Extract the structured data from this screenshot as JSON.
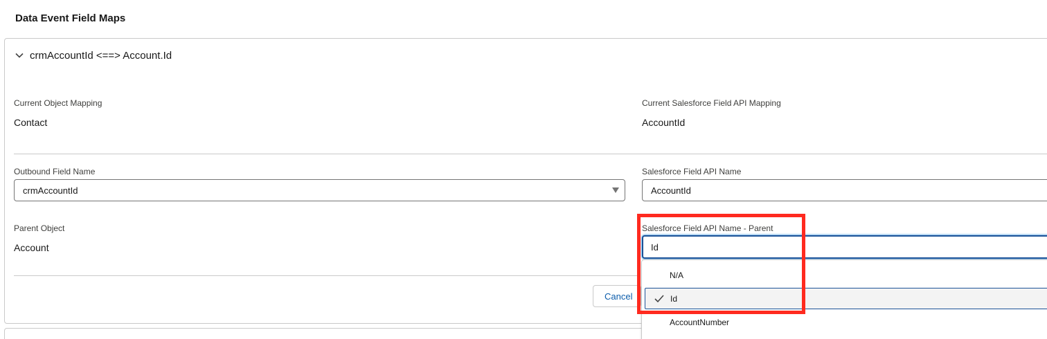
{
  "page": {
    "title": "Data Event Field Maps"
  },
  "section": {
    "title": "crmAccountId <==> Account.Id",
    "current_object_label": "Current Object Mapping",
    "current_object_value": "Contact",
    "current_field_label": "Current Salesforce Field API Mapping",
    "current_field_value": "AccountId",
    "outbound_label": "Outbound Field Name",
    "outbound_value": "crmAccountId",
    "sf_field_label": "Salesforce Field API Name",
    "sf_field_value": "AccountId",
    "parent_object_label": "Parent Object",
    "parent_object_value": "Account",
    "sf_parent_label": "Salesforce Field API Name - Parent",
    "sf_parent_value": "Id",
    "dropdown_options": [
      "N/A",
      "Id",
      "AccountNumber"
    ],
    "selected_option": "Id",
    "cancel_label": "Cancel"
  },
  "colors": {
    "focus_border": "#1b5297",
    "link": "#0b5cab",
    "highlight": "#ff2a1f"
  },
  "icons": {
    "chevron": "chevron-down-icon",
    "caret": "caret-down-icon",
    "check": "check-icon"
  }
}
